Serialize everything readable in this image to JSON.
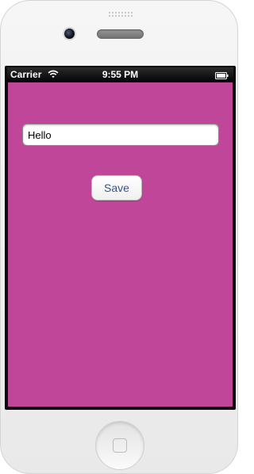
{
  "status_bar": {
    "carrier": "Carrier",
    "time": "9:55 PM",
    "wifi_icon": "wifi-icon",
    "battery_icon": "battery-icon"
  },
  "app": {
    "background_color": "#c0469a",
    "text_field": {
      "value": "Hello",
      "placeholder": ""
    },
    "save_button": {
      "label": "Save",
      "text_color": "#385487"
    }
  },
  "device": {
    "home_button_icon": "home-button-icon"
  }
}
